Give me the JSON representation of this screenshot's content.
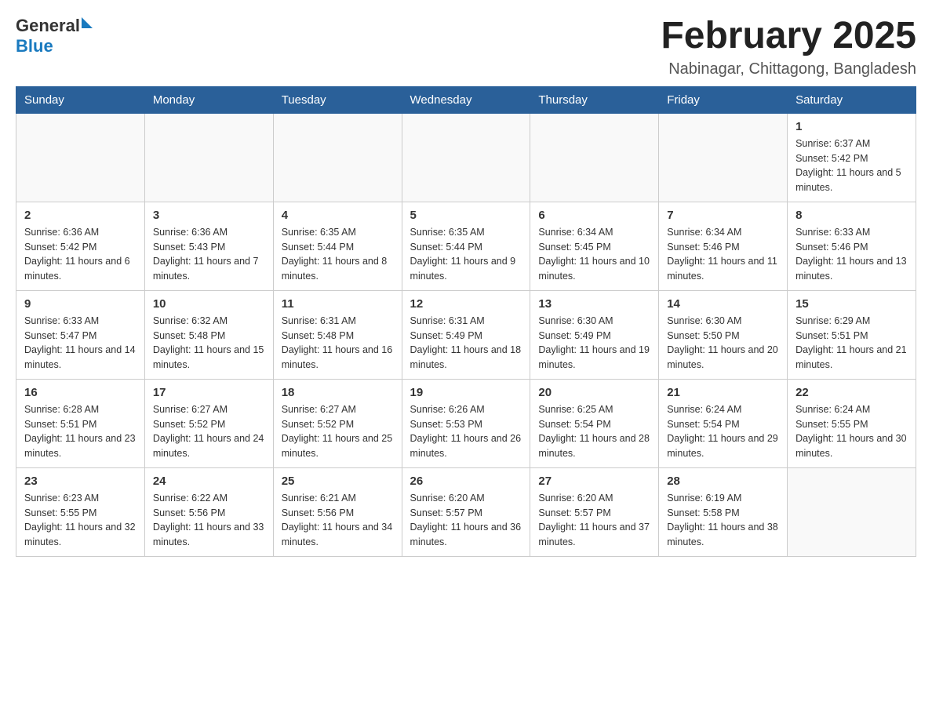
{
  "logo": {
    "general": "General",
    "blue": "Blue"
  },
  "header": {
    "month": "February 2025",
    "location": "Nabinagar, Chittagong, Bangladesh"
  },
  "weekdays": [
    "Sunday",
    "Monday",
    "Tuesday",
    "Wednesday",
    "Thursday",
    "Friday",
    "Saturday"
  ],
  "weeks": [
    [
      {
        "day": "",
        "info": ""
      },
      {
        "day": "",
        "info": ""
      },
      {
        "day": "",
        "info": ""
      },
      {
        "day": "",
        "info": ""
      },
      {
        "day": "",
        "info": ""
      },
      {
        "day": "",
        "info": ""
      },
      {
        "day": "1",
        "info": "Sunrise: 6:37 AM\nSunset: 5:42 PM\nDaylight: 11 hours and 5 minutes."
      }
    ],
    [
      {
        "day": "2",
        "info": "Sunrise: 6:36 AM\nSunset: 5:42 PM\nDaylight: 11 hours and 6 minutes."
      },
      {
        "day": "3",
        "info": "Sunrise: 6:36 AM\nSunset: 5:43 PM\nDaylight: 11 hours and 7 minutes."
      },
      {
        "day": "4",
        "info": "Sunrise: 6:35 AM\nSunset: 5:44 PM\nDaylight: 11 hours and 8 minutes."
      },
      {
        "day": "5",
        "info": "Sunrise: 6:35 AM\nSunset: 5:44 PM\nDaylight: 11 hours and 9 minutes."
      },
      {
        "day": "6",
        "info": "Sunrise: 6:34 AM\nSunset: 5:45 PM\nDaylight: 11 hours and 10 minutes."
      },
      {
        "day": "7",
        "info": "Sunrise: 6:34 AM\nSunset: 5:46 PM\nDaylight: 11 hours and 11 minutes."
      },
      {
        "day": "8",
        "info": "Sunrise: 6:33 AM\nSunset: 5:46 PM\nDaylight: 11 hours and 13 minutes."
      }
    ],
    [
      {
        "day": "9",
        "info": "Sunrise: 6:33 AM\nSunset: 5:47 PM\nDaylight: 11 hours and 14 minutes."
      },
      {
        "day": "10",
        "info": "Sunrise: 6:32 AM\nSunset: 5:48 PM\nDaylight: 11 hours and 15 minutes."
      },
      {
        "day": "11",
        "info": "Sunrise: 6:31 AM\nSunset: 5:48 PM\nDaylight: 11 hours and 16 minutes."
      },
      {
        "day": "12",
        "info": "Sunrise: 6:31 AM\nSunset: 5:49 PM\nDaylight: 11 hours and 18 minutes."
      },
      {
        "day": "13",
        "info": "Sunrise: 6:30 AM\nSunset: 5:49 PM\nDaylight: 11 hours and 19 minutes."
      },
      {
        "day": "14",
        "info": "Sunrise: 6:30 AM\nSunset: 5:50 PM\nDaylight: 11 hours and 20 minutes."
      },
      {
        "day": "15",
        "info": "Sunrise: 6:29 AM\nSunset: 5:51 PM\nDaylight: 11 hours and 21 minutes."
      }
    ],
    [
      {
        "day": "16",
        "info": "Sunrise: 6:28 AM\nSunset: 5:51 PM\nDaylight: 11 hours and 23 minutes."
      },
      {
        "day": "17",
        "info": "Sunrise: 6:27 AM\nSunset: 5:52 PM\nDaylight: 11 hours and 24 minutes."
      },
      {
        "day": "18",
        "info": "Sunrise: 6:27 AM\nSunset: 5:52 PM\nDaylight: 11 hours and 25 minutes."
      },
      {
        "day": "19",
        "info": "Sunrise: 6:26 AM\nSunset: 5:53 PM\nDaylight: 11 hours and 26 minutes."
      },
      {
        "day": "20",
        "info": "Sunrise: 6:25 AM\nSunset: 5:54 PM\nDaylight: 11 hours and 28 minutes."
      },
      {
        "day": "21",
        "info": "Sunrise: 6:24 AM\nSunset: 5:54 PM\nDaylight: 11 hours and 29 minutes."
      },
      {
        "day": "22",
        "info": "Sunrise: 6:24 AM\nSunset: 5:55 PM\nDaylight: 11 hours and 30 minutes."
      }
    ],
    [
      {
        "day": "23",
        "info": "Sunrise: 6:23 AM\nSunset: 5:55 PM\nDaylight: 11 hours and 32 minutes."
      },
      {
        "day": "24",
        "info": "Sunrise: 6:22 AM\nSunset: 5:56 PM\nDaylight: 11 hours and 33 minutes."
      },
      {
        "day": "25",
        "info": "Sunrise: 6:21 AM\nSunset: 5:56 PM\nDaylight: 11 hours and 34 minutes."
      },
      {
        "day": "26",
        "info": "Sunrise: 6:20 AM\nSunset: 5:57 PM\nDaylight: 11 hours and 36 minutes."
      },
      {
        "day": "27",
        "info": "Sunrise: 6:20 AM\nSunset: 5:57 PM\nDaylight: 11 hours and 37 minutes."
      },
      {
        "day": "28",
        "info": "Sunrise: 6:19 AM\nSunset: 5:58 PM\nDaylight: 11 hours and 38 minutes."
      },
      {
        "day": "",
        "info": ""
      }
    ]
  ]
}
